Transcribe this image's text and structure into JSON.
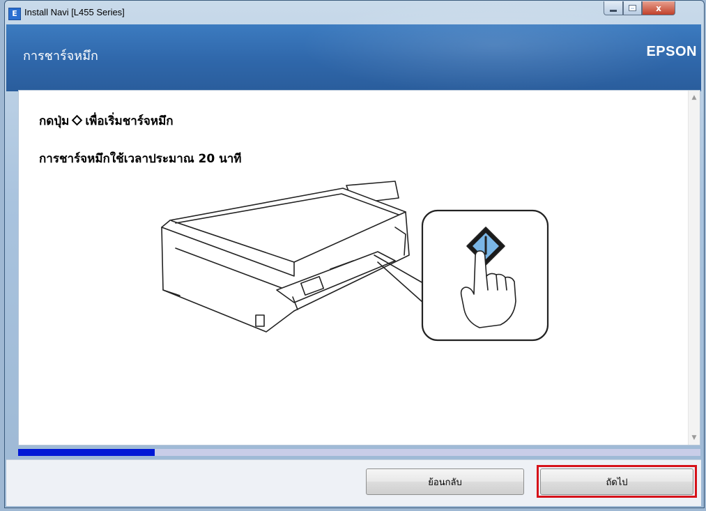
{
  "window": {
    "title": "Install Navi [L455 Series]",
    "app_icon": "E",
    "controls": [
      "minimize-icon",
      "maximize-icon",
      "close-icon"
    ],
    "close_glyph": "x"
  },
  "header": {
    "title": "การชาร์จหมึก",
    "brand": "EPSON"
  },
  "content": {
    "instruction_before": "กดปุ่ม",
    "instruction_icon": "start-diamond-icon",
    "instruction_after": "เพื่อเริ่มชาร์จหมึก",
    "note": "การชาร์จหมึกใช้เวลาประมาณ 20 นาที",
    "illustration": "printer-press-start-button",
    "scroll_up": "▲",
    "scroll_down": "▼"
  },
  "progress": {
    "fraction": 0.2
  },
  "footer": {
    "back_label": "ย้อนกลับ",
    "next_label": "ถัดไป",
    "highlight_color": "#d6121a"
  },
  "colors": {
    "header_bg": "#2f67aa",
    "progress_fill": "#0018d6",
    "progress_track": "#c9cde8"
  }
}
